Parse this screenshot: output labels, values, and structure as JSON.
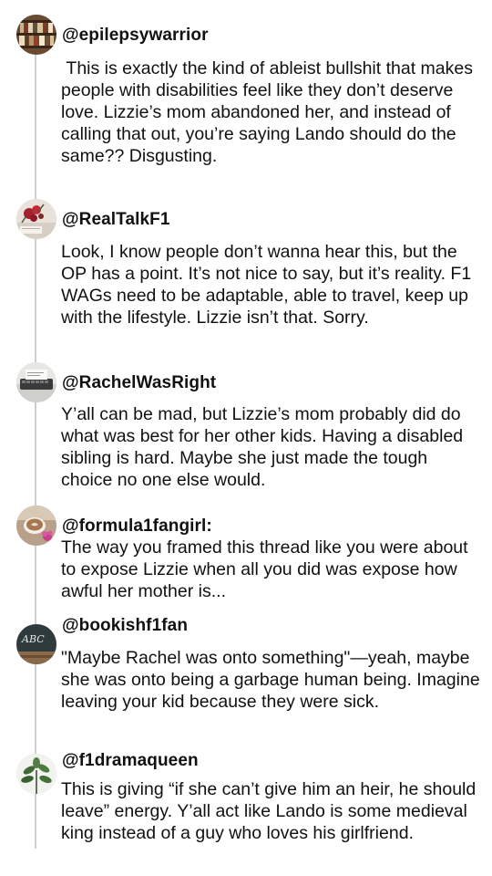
{
  "posts": [
    {
      "handle": "@epilepsywarrior",
      "avatar_icon": "bookshelf-avatar",
      "text": " This is exactly the kind of ableist bullshit that makes people with disabilities feel like they don’t deserve love. Lizzie’s mom abandoned her, and instead of calling that out, you’re saying Lando should do the same?? Disgusting."
    },
    {
      "handle": "@RealTalkF1",
      "avatar_icon": "roses-avatar",
      "text": "Look, I know people don’t wanna hear this, but the OP has a point. It’s not nice to say, but it’s reality. F1 WAGs need to be adaptable, able to travel, keep up with the lifestyle. Lizzie isn’t that. Sorry."
    },
    {
      "handle": "@RachelWasRight",
      "avatar_icon": "typewriter-avatar",
      "text": "Y’all can be mad, but Lizzie’s mom probably did do what was best for her other kids. Having a disabled sibling is hard. Maybe she just made the tough choice no one else would."
    },
    {
      "handle": "@formula1fangirl:",
      "avatar_icon": "coffee-flower-avatar",
      "text": "The way you framed this thread like you were about to expose Lizzie when all you did was expose how awful her mother is..."
    },
    {
      "handle": "@bookishf1fan",
      "avatar_icon": "chalkboard-avatar",
      "avatar_label": "ABC",
      "text": "\"Maybe Rachel was onto something\"—yeah, maybe she was onto being a garbage human being. Imagine leaving your kid because they were sick."
    },
    {
      "handle": "@f1dramaqueen",
      "avatar_icon": "plant-avatar",
      "text": "This is giving “if she can’t give him an heir, he should leave” energy. Y’all act like Lando is some medieval king instead of a guy who loves his girlfriend."
    }
  ]
}
